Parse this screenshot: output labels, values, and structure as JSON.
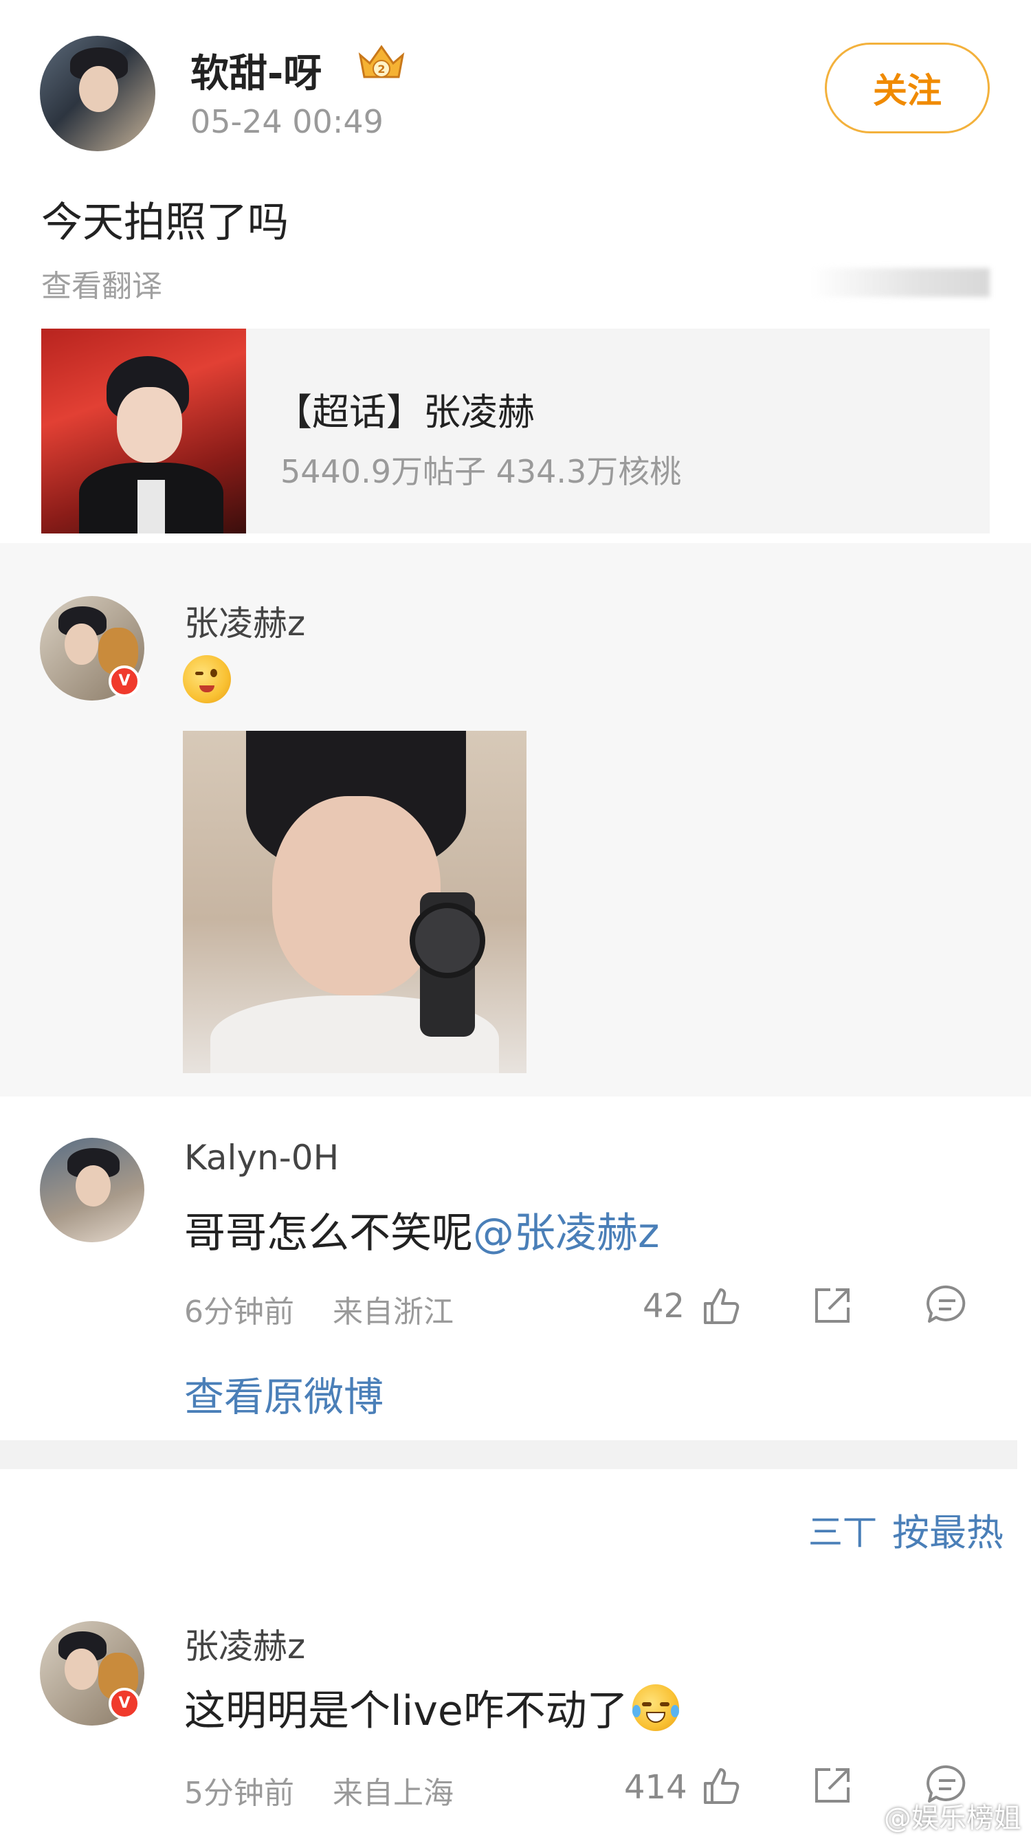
{
  "post": {
    "username": "软甜-呀",
    "timestamp": "05-24 00:49",
    "follow_label": "关注",
    "text": "今天拍照了吗",
    "translate_label": "查看翻译"
  },
  "topic": {
    "title": "【超话】张凌赫",
    "stats": "5440.9万帖子 434.3万核桃"
  },
  "quoted": {
    "username": "张凌赫z"
  },
  "comment1": {
    "username": "Kalyn-0H",
    "text": "哥哥怎么不笑呢",
    "mention": "@张凌赫z",
    "time": "6分钟前",
    "location": "来自浙江",
    "likes": "42",
    "view_original": "查看原微博"
  },
  "sort": {
    "label": "按最热",
    "icon_text": "三丅"
  },
  "comment2": {
    "username": "张凌赫z",
    "text": "这明明是个live咋不动了",
    "time": "5分钟前",
    "location": "来自上海",
    "likes": "414"
  },
  "watermark": "@娱乐榜姐",
  "colors": {
    "accent_orange": "#f08a00",
    "link_blue": "#4a7fb8",
    "verified_red": "#f03a2c"
  }
}
